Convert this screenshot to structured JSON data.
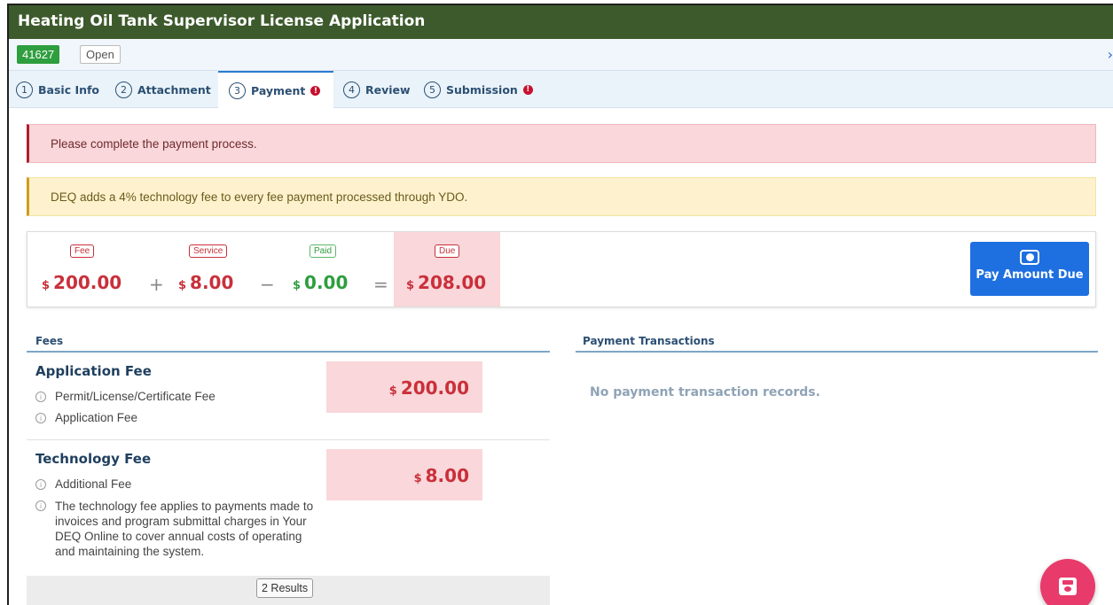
{
  "app": {
    "title": "Heating Oil Tank Supervisor License Application"
  },
  "record": {
    "id": "41627",
    "status": "Open"
  },
  "tabs": [
    {
      "num": "1",
      "label": "Basic Info",
      "error": false
    },
    {
      "num": "2",
      "label": "Attachment",
      "error": false
    },
    {
      "num": "3",
      "label": "Payment",
      "error": true
    },
    {
      "num": "4",
      "label": "Review",
      "error": false
    },
    {
      "num": "5",
      "label": "Submission",
      "error": true
    }
  ],
  "alerts": {
    "error": "Please complete the payment process.",
    "warning": "DEQ adds a 4% technology fee to every fee payment processed through YDO."
  },
  "summary": {
    "currency": "$",
    "fee": {
      "label": "Fee",
      "value": "200.00"
    },
    "service": {
      "label": "Service",
      "value": "8.00"
    },
    "paid": {
      "label": "Paid",
      "value": "0.00"
    },
    "due": {
      "label": "Due",
      "value": "208.00"
    },
    "op_plus": "+",
    "op_minus": "−",
    "op_equals": "=",
    "pay_button": "Pay Amount Due"
  },
  "fees": {
    "title": "Fees",
    "items": [
      {
        "name": "Application Fee",
        "amount": "200.00",
        "lines": [
          "Permit/License/Certificate Fee",
          "Application Fee"
        ]
      },
      {
        "name": "Technology Fee",
        "amount": "8.00",
        "lines": [
          "Additional Fee",
          "The technology fee applies to payments made to invoices and program submittal charges in Your DEQ Online to cover annual costs of operating and maintaining the system."
        ]
      }
    ],
    "results": "2 Results"
  },
  "transactions": {
    "title": "Payment Transactions",
    "empty": "No payment transaction records."
  },
  "icons": {
    "info": "i",
    "error": "!",
    "chevron": "›"
  },
  "colors": {
    "header": "#3d5a2c",
    "accent": "#1e6fe0",
    "fab": "#e83a6b",
    "due": "#c9303a",
    "paid": "#2e9e3e"
  }
}
